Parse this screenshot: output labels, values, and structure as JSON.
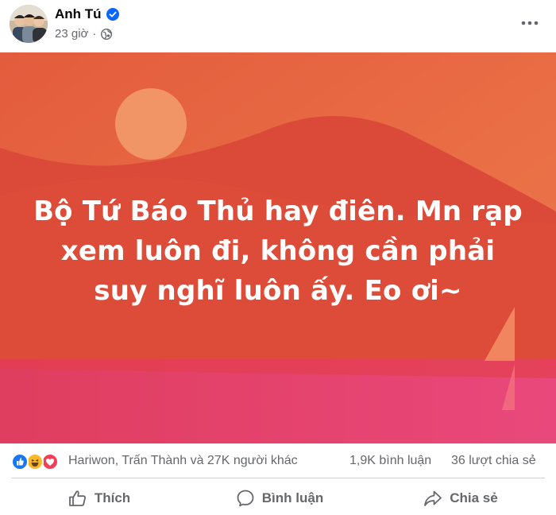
{
  "post": {
    "author": "Anh Tú",
    "time": "23 giờ",
    "dot": "·",
    "text": "Bộ Tứ Báo Thủ hay điên. Mn rạp xem luôn đi, không cần phải suy nghĩ luôn ấy. Eo ơi~",
    "background_colors": {
      "sky": "#e85e3f",
      "sun": "#f2a070",
      "mountain": "#de4d3a",
      "ground": "#e2416a"
    }
  },
  "reactions": {
    "icons": [
      "like-icon",
      "haha-icon",
      "love-icon"
    ],
    "summary": "Hariwon, Trấn Thành và 27K người khác",
    "comments": "1,9K bình luận",
    "shares": "36 lượt chia sẻ"
  },
  "actions": {
    "like": "Thích",
    "comment": "Bình luận",
    "share": "Chia sẻ"
  },
  "colors": {
    "accent": "#0866ff",
    "secondary_text": "#65676b"
  }
}
